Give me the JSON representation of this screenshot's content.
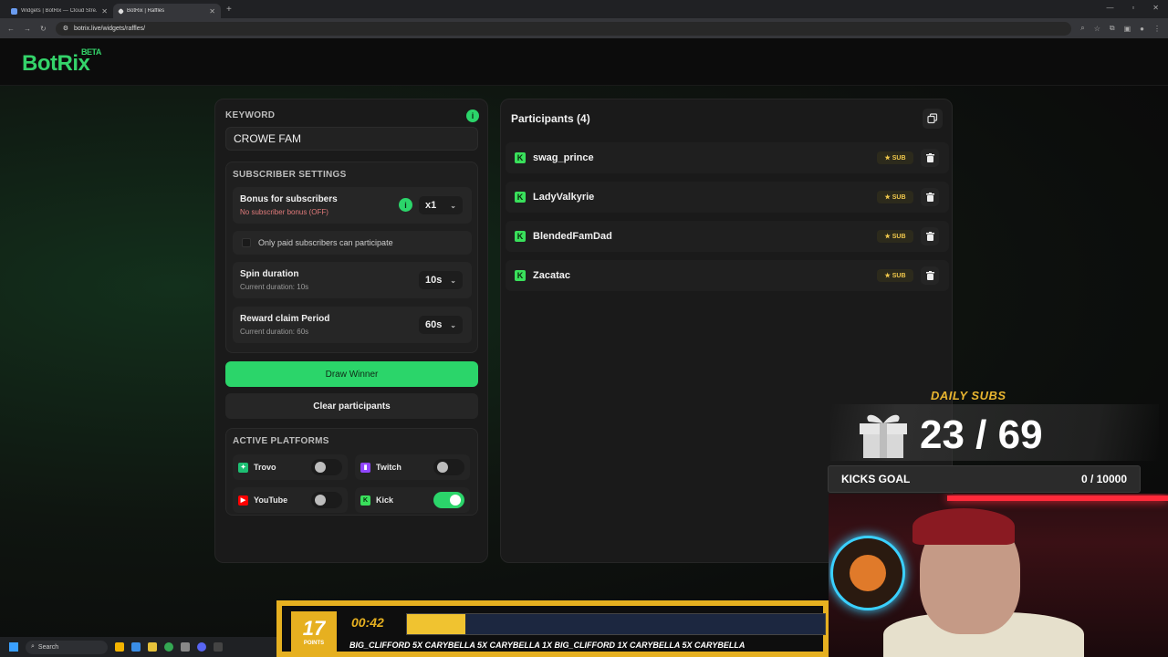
{
  "browser": {
    "tabs": [
      {
        "title": "Widgets | BotRix — Cloud Stre..."
      },
      {
        "title": "BotRix | Raffles"
      }
    ],
    "url": "botrix.live/widgets/raffles/"
  },
  "brand": {
    "name": "BotRix",
    "badge": "BETA",
    "accent": "#2bd56a"
  },
  "keyword": {
    "label": "KEYWORD",
    "value": "CROWE FAM"
  },
  "subscriber_settings": {
    "label": "SUBSCRIBER SETTINGS",
    "bonus": {
      "title": "Bonus for subscribers",
      "subtitle": "No subscriber bonus (OFF)",
      "value": "x1"
    },
    "paid_only": {
      "label": "Only paid subscribers can participate",
      "checked": false
    },
    "spin": {
      "title": "Spin duration",
      "subtitle": "Current duration: 10s",
      "value": "10s"
    },
    "reward": {
      "title": "Reward claim Period",
      "subtitle": "Current duration: 60s",
      "value": "60s"
    }
  },
  "actions": {
    "draw": "Draw Winner",
    "clear": "Clear participants"
  },
  "platforms": {
    "label": "ACTIVE PLATFORMS",
    "items": [
      {
        "name": "Trovo",
        "enabled": false,
        "color": "#1dbf73"
      },
      {
        "name": "Twitch",
        "enabled": false,
        "color": "#9146ff"
      },
      {
        "name": "YouTube",
        "enabled": false,
        "color": "#ff0000"
      },
      {
        "name": "Kick",
        "enabled": true,
        "color": "#39e05b"
      }
    ]
  },
  "participants": {
    "title": "Participants (4)",
    "items": [
      {
        "name": "swag_prince",
        "badge": "SUB"
      },
      {
        "name": "LadyValkyrie",
        "badge": "SUB"
      },
      {
        "name": "BlendedFamDad",
        "badge": "SUB"
      },
      {
        "name": "Zacatac",
        "badge": "SUB"
      }
    ]
  },
  "overlay": {
    "daily_subs_label": "DAILY SUBS",
    "daily_subs": "23 / 69",
    "goal_label": "KICKS GOAL",
    "goal_value": "0 / 10000",
    "points": "17",
    "points_label": "POINTS",
    "timer": "00:42",
    "progress": 0.14,
    "ticker": "BIG_CLIFFORD 5X   CARYBELLA 5X   CARYBELLA 1X   BIG_CLIFFORD 1X   CARYBELLA 5X   CARYBELLA"
  },
  "taskbar": {
    "search": "Search"
  }
}
